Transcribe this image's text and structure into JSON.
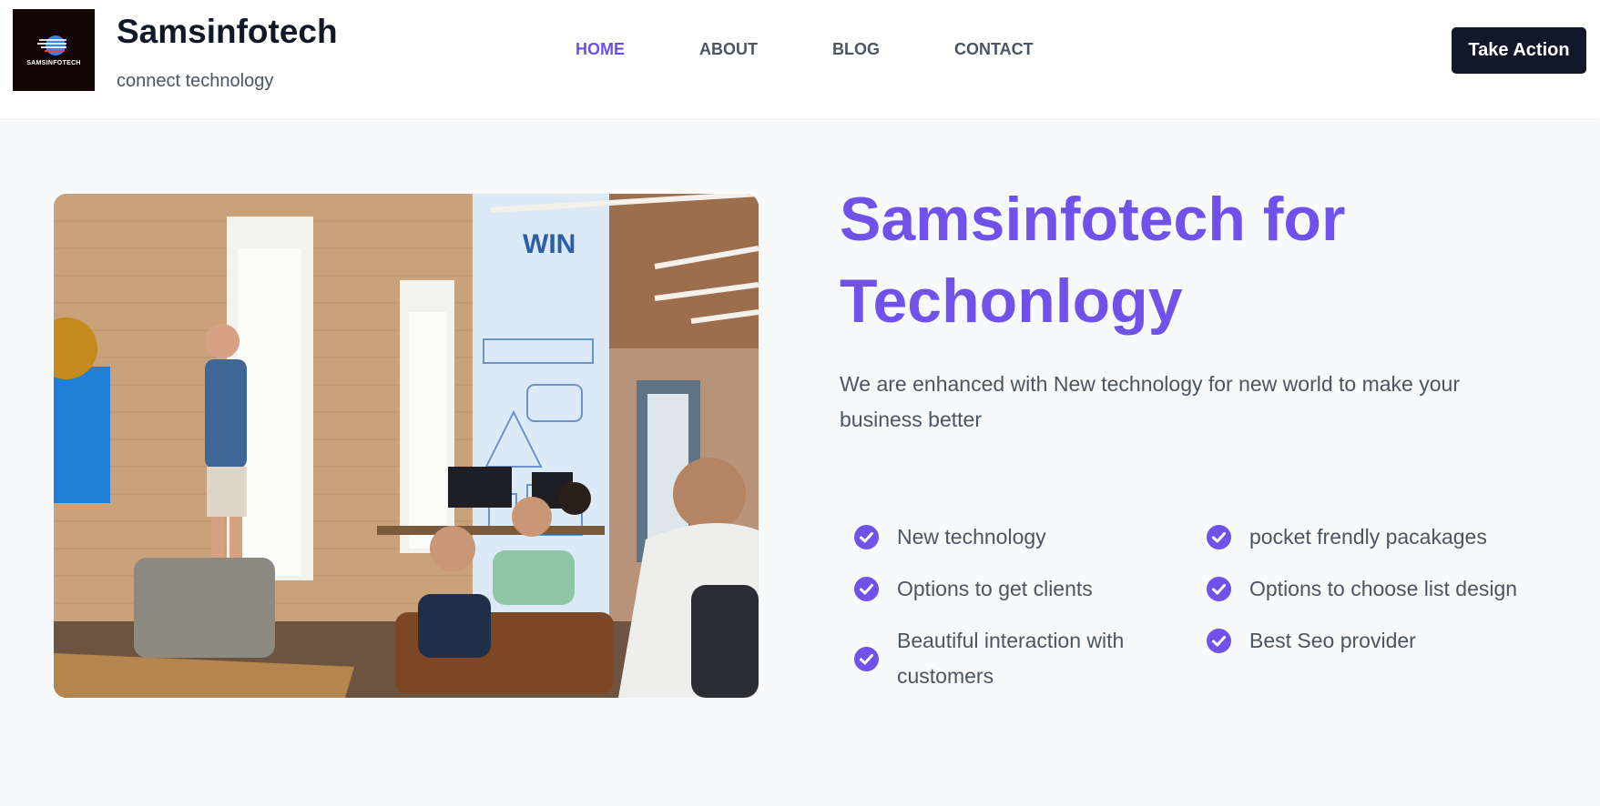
{
  "header": {
    "logo_text": "SAMSINFOTECH",
    "brand_name": "Samsinfotech",
    "tagline": "connect technology",
    "nav": [
      {
        "label": "HOME",
        "active": true
      },
      {
        "label": "ABOUT",
        "active": false
      },
      {
        "label": "BLOG",
        "active": false
      },
      {
        "label": "CONTACT",
        "active": false
      }
    ],
    "cta_label": "Take Action"
  },
  "hero": {
    "image_icon": "office-meeting-photo",
    "title": "Samsinfotech for Techonlogy",
    "description": "We are enhanced with New technology for new world to make your business better",
    "wall_text": "WIN",
    "features": [
      "New technology",
      "pocket frendly pacakages",
      "Options to get clients",
      "Options to choose list design",
      "Beautiful interaction with customers",
      "Best Seo provider"
    ]
  },
  "colors": {
    "accent": "#7051ea",
    "nav_active": "#6d4fe8",
    "button_bg": "#111827",
    "page_bg": "#f8f9fb",
    "check_icon": "#7051ea"
  }
}
